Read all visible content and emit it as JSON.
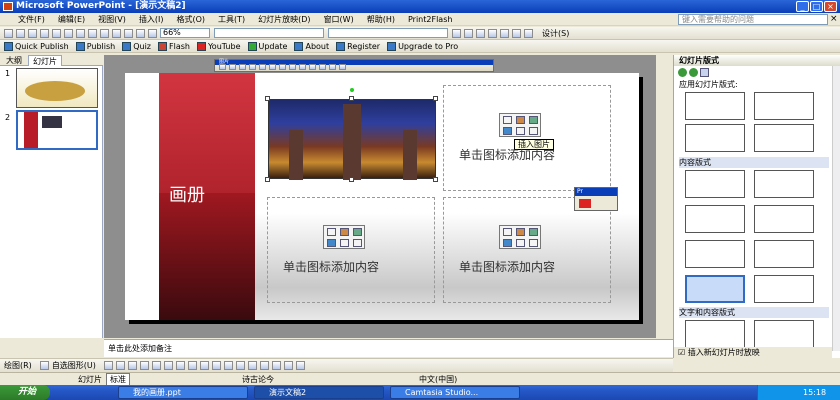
{
  "window": {
    "title": "Microsoft PowerPoint - [演示文稿2]",
    "min": "_",
    "max": "□",
    "close": "×",
    "doc_close": "×"
  },
  "menu": {
    "items": [
      "文件(F)",
      "编辑(E)",
      "视图(V)",
      "插入(I)",
      "格式(O)",
      "工具(T)",
      "幻灯片放映(D)",
      "窗口(W)",
      "帮助(H)",
      "Print2Flash"
    ],
    "help_placeholder": "键入需要帮助的问题"
  },
  "toolbar": {
    "zoom": "66%",
    "design_label": "设计(S)"
  },
  "quickbar": {
    "items": [
      "Quick Publish",
      "Publish",
      "Quiz",
      "Flash",
      "YouTube",
      "Update",
      "About",
      "Register",
      "Upgrade to Pro"
    ]
  },
  "picture_toolbar": {
    "title": "图片"
  },
  "left_pane": {
    "tabs": [
      "大纲",
      "幻灯片"
    ],
    "slides": [
      "1",
      "2"
    ]
  },
  "slide": {
    "title": "画册",
    "placeholder_text": "单击图标添加内容",
    "tooltip": "插入图片"
  },
  "notes": {
    "placeholder": "单击此处添加备注"
  },
  "right_pane": {
    "title": "幻灯片版式",
    "section_apply": "应用幻灯片版式:",
    "section_content": "内容版式",
    "section_text_content": "文字和内容版式",
    "show_on_insert": "插入新幻灯片时放映"
  },
  "floating": {
    "title": "Pr"
  },
  "drawbar": {
    "draw_label": "绘图(R)",
    "autoshape_label": "自选图形(U)"
  },
  "status": {
    "slide": "幻灯片",
    "ime": "标准",
    "design": "诗古论今",
    "lang": "中文(中国)"
  },
  "taskbar": {
    "start": "开始",
    "tasks": [
      "我的画册.ppt",
      "演示文稿2",
      "Camtasia Studio..."
    ],
    "time": "15:18"
  }
}
